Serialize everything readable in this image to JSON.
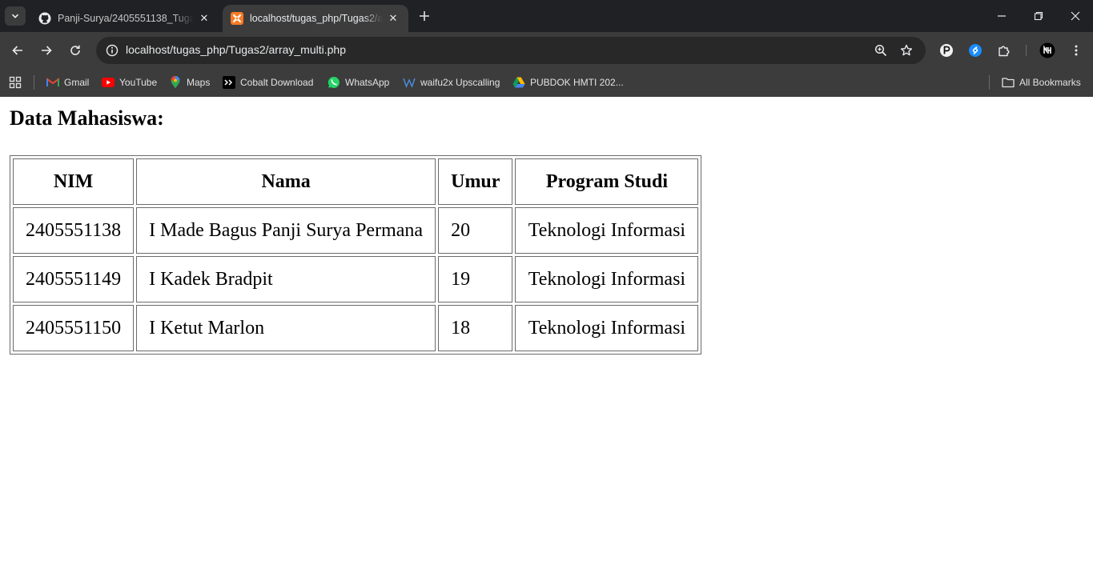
{
  "browser": {
    "tabs": [
      {
        "title": "Panji-Surya/2405551138_Tugas",
        "active": false,
        "icon": "github-icon"
      },
      {
        "title": "localhost/tugas_php/Tugas2/array_multi.php",
        "active": true,
        "icon": "xampp-icon"
      }
    ],
    "url": "localhost/tugas_php/Tugas2/array_multi.php",
    "bookmarks": [
      {
        "label": "Gmail",
        "icon": "gmail-icon"
      },
      {
        "label": "YouTube",
        "icon": "youtube-icon"
      },
      {
        "label": "Maps",
        "icon": "maps-icon"
      },
      {
        "label": "Cobalt Download",
        "icon": "cobalt-icon"
      },
      {
        "label": "WhatsApp",
        "icon": "whatsapp-icon"
      },
      {
        "label": "waifu2x Upscalling",
        "icon": "waifu2x-icon"
      },
      {
        "label": "PUBDOK HMTI 202...",
        "icon": "google-drive-icon"
      }
    ],
    "all_bookmarks_label": "All Bookmarks"
  },
  "page": {
    "heading": "Data Mahasiswa:",
    "table": {
      "headers": [
        "NIM",
        "Nama",
        "Umur",
        "Program Studi"
      ],
      "rows": [
        [
          "2405551138",
          "I Made Bagus Panji Surya Permana",
          "20",
          "Teknologi Informasi"
        ],
        [
          "2405551149",
          "I Kadek Bradpit",
          "19",
          "Teknologi Informasi"
        ],
        [
          "2405551150",
          "I Ketut Marlon",
          "18",
          "Teknologi Informasi"
        ]
      ]
    }
  },
  "colors": {
    "chrome_dark": "#202124",
    "chrome_toolbar": "#3c3c3c",
    "omnibox": "#282828",
    "xampp": "#fb7a24"
  }
}
